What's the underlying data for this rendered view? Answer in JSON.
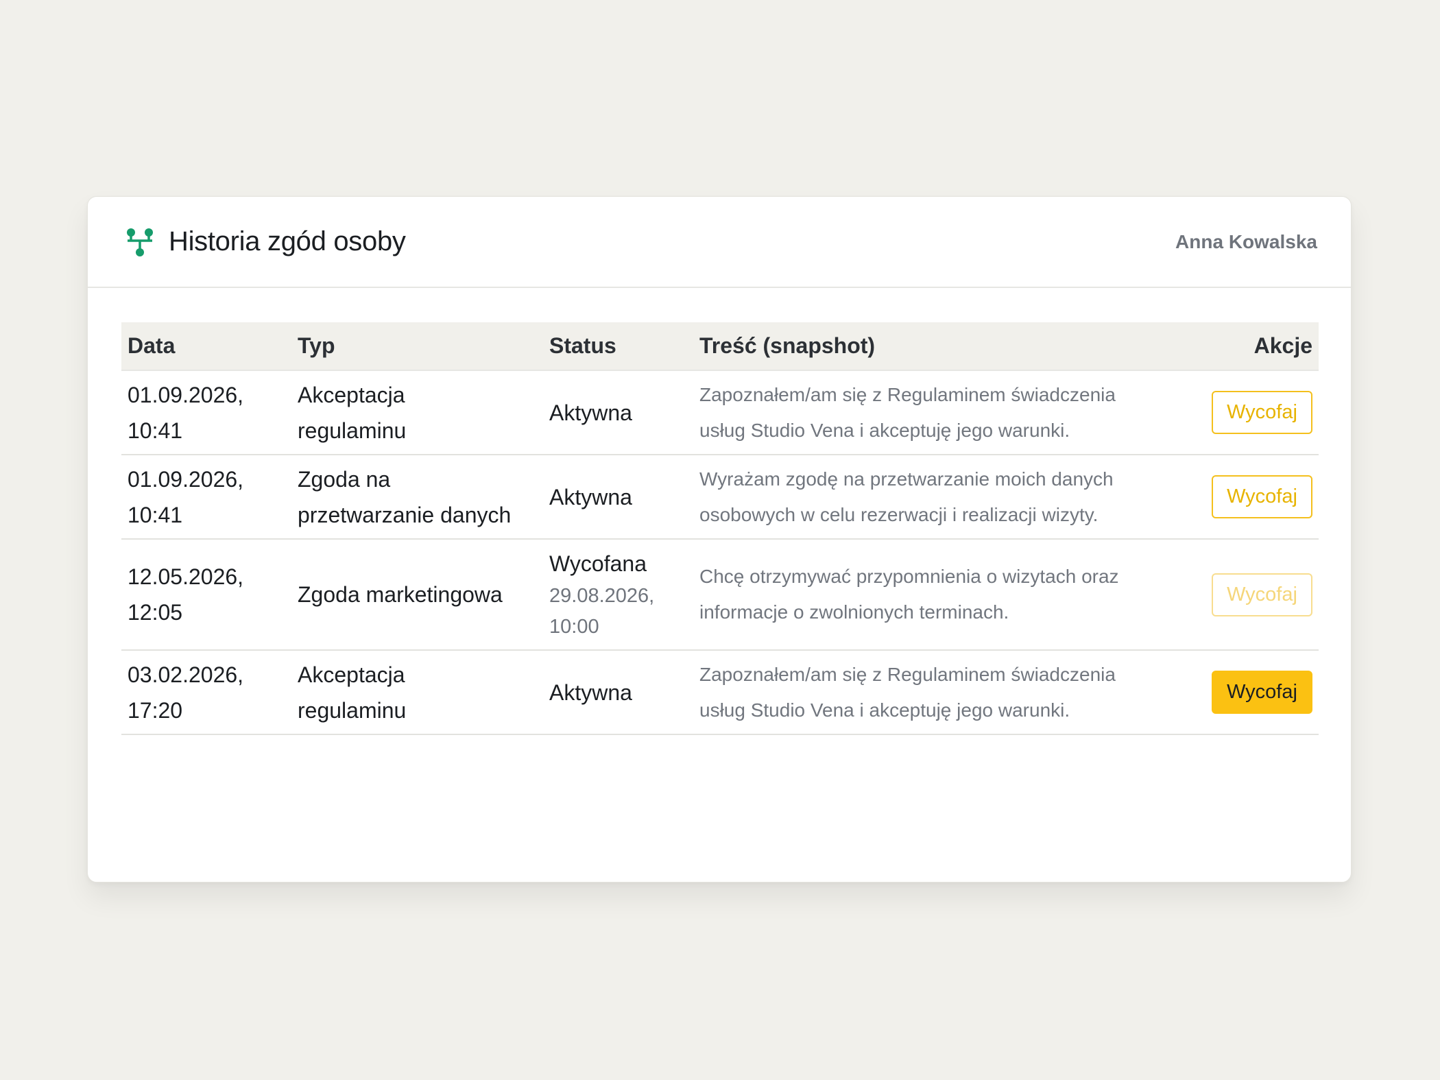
{
  "header": {
    "title": "Historia zgód osoby",
    "person_name": "Anna Kowalska",
    "accent_color": "#169c6b"
  },
  "table": {
    "columns": [
      "Data",
      "Typ",
      "Status",
      "Treść (snapshot)",
      "Akcje"
    ],
    "rows": [
      {
        "date_line1": "01.09.2026,",
        "date_line2": "10:41",
        "type_line1": "Akceptacja",
        "type_line2": "regulaminu",
        "status": "Aktywna",
        "content_line1": "Zapoznałem/am się z Regulaminem świadczenia",
        "content_line2": "usług Studio Vena i akceptuję jego warunki.",
        "action_label": "Wycofaj",
        "action_state": "enabled"
      },
      {
        "date_line1": "01.09.2026,",
        "date_line2": "10:41",
        "type_line1": "Zgoda na",
        "type_line2": "przetwarzanie danych",
        "status": "Aktywna",
        "content_line1": "Wyrażam zgodę na przetwarzanie moich danych",
        "content_line2": "osobowych w celu rezerwacji i realizacji wizyty.",
        "action_label": "Wycofaj",
        "action_state": "enabled"
      },
      {
        "date_line1": "12.05.2026,",
        "date_line2": "12:05",
        "type_line1": "Zgoda marketingowa",
        "status": "Wycofana",
        "status_date_line1": "29.08.2026,",
        "status_date_line2": "10:00",
        "content_line1": "Chcę otrzymywać przypomnienia o wizytach oraz",
        "content_line2": "informacje o zwolnionych terminach.",
        "action_label": "Wycofaj",
        "action_state": "disabled"
      },
      {
        "date_line1": "03.02.2026,",
        "date_line2": "17:20",
        "type_line1": "Akceptacja",
        "type_line2": "regulaminu",
        "status": "Aktywna",
        "content_line1": "Zapoznałem/am się z Regulaminem świadczenia",
        "content_line2": "usług Studio Vena i akceptuję jego warunki.",
        "action_label": "Wycofaj",
        "action_state": "highlighted"
      }
    ]
  }
}
